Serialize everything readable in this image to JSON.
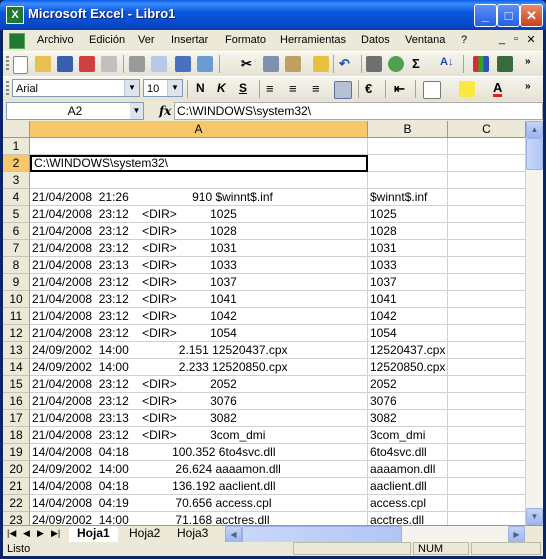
{
  "window": {
    "title": "Microsoft Excel - Libro1"
  },
  "menu": [
    "Archivo",
    "Edición",
    "Ver",
    "Insertar",
    "Formato",
    "Herramientas",
    "Datos",
    "Ventana",
    "?"
  ],
  "format_bar": {
    "font": "Arial",
    "size": "10"
  },
  "formula_bar": {
    "name_box": "A2",
    "fx": "fx",
    "formula": "C:\\WINDOWS\\system32\\"
  },
  "columns": [
    "A",
    "B",
    "C"
  ],
  "rows": [
    {
      "n": "1",
      "a": "",
      "b": ""
    },
    {
      "n": "2",
      "a": "C:\\WINDOWS\\system32\\",
      "b": ""
    },
    {
      "n": "3",
      "a": "",
      "b": ""
    },
    {
      "n": "4",
      "a": "21/04/2008  21:26                   910 $winnt$.inf",
      "b": "$winnt$.inf"
    },
    {
      "n": "5",
      "a": "21/04/2008  23:12    <DIR>          1025",
      "b": "1025"
    },
    {
      "n": "6",
      "a": "21/04/2008  23:12    <DIR>          1028",
      "b": "1028"
    },
    {
      "n": "7",
      "a": "21/04/2008  23:12    <DIR>          1031",
      "b": "1031"
    },
    {
      "n": "8",
      "a": "21/04/2008  23:13    <DIR>          1033",
      "b": "1033"
    },
    {
      "n": "9",
      "a": "21/04/2008  23:12    <DIR>          1037",
      "b": "1037"
    },
    {
      "n": "10",
      "a": "21/04/2008  23:12    <DIR>          1041",
      "b": "1041"
    },
    {
      "n": "11",
      "a": "21/04/2008  23:12    <DIR>          1042",
      "b": "1042"
    },
    {
      "n": "12",
      "a": "21/04/2008  23:12    <DIR>          1054",
      "b": "1054"
    },
    {
      "n": "13",
      "a": "24/09/2002  14:00               2.151 12520437.cpx",
      "b": "12520437.cpx"
    },
    {
      "n": "14",
      "a": "24/09/2002  14:00               2.233 12520850.cpx",
      "b": "12520850.cpx"
    },
    {
      "n": "15",
      "a": "21/04/2008  23:12    <DIR>          2052",
      "b": "2052"
    },
    {
      "n": "16",
      "a": "21/04/2008  23:12    <DIR>          3076",
      "b": "3076"
    },
    {
      "n": "17",
      "a": "21/04/2008  23:13    <DIR>          3082",
      "b": "3082"
    },
    {
      "n": "18",
      "a": "21/04/2008  23:12    <DIR>          3com_dmi",
      "b": "3com_dmi"
    },
    {
      "n": "19",
      "a": "14/04/2008  04:18             100.352 6to4svc.dll",
      "b": "6to4svc.dll"
    },
    {
      "n": "20",
      "a": "24/09/2002  14:00              26.624 aaaamon.dll",
      "b": "aaaamon.dll"
    },
    {
      "n": "21",
      "a": "14/04/2008  04:18             136.192 aaclient.dll",
      "b": "aaclient.dll"
    },
    {
      "n": "22",
      "a": "14/04/2008  04:19              70.656 access.cpl",
      "b": "access.cpl"
    },
    {
      "n": "23",
      "a": "24/09/2002  14:00              71.168 acctres.dll",
      "b": "acctres.dll"
    }
  ],
  "sheets": [
    "Hoja1",
    "Hoja2",
    "Hoja3"
  ],
  "status": {
    "text": "Listo",
    "num": "NUM"
  }
}
